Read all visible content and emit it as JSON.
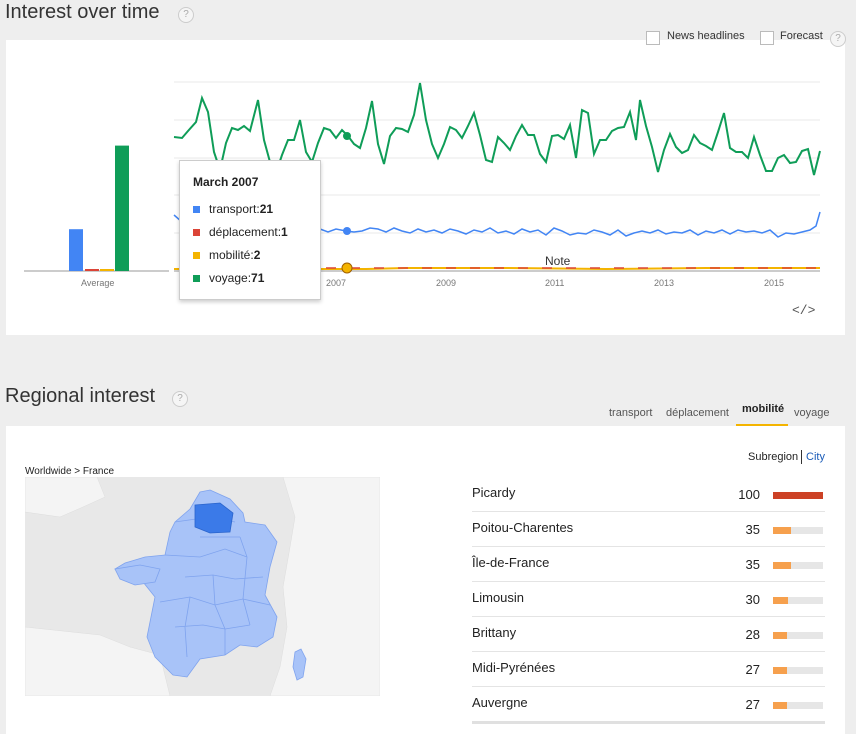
{
  "interest": {
    "title": "Interest over time",
    "help": "?",
    "news_label": "News headlines",
    "forecast_label": "Forecast",
    "average_label": "Average",
    "note_label": "Note",
    "embed_label": "</>",
    "years": [
      "2007",
      "2009",
      "2011",
      "2013",
      "2015"
    ],
    "averages": [
      {
        "name": "transport",
        "value": 22,
        "color": "#4285f4"
      },
      {
        "name": "déplacement",
        "value": 1,
        "color": "#db4437"
      },
      {
        "name": "mobilité",
        "value": 1,
        "color": "#f4b400"
      },
      {
        "name": "voyage",
        "value": 66,
        "color": "#0f9d58"
      }
    ],
    "tooltip": {
      "date": "March 2007",
      "rows": [
        {
          "label": "transport: ",
          "value": "21",
          "color": "#4285f4"
        },
        {
          "label": "déplacement: ",
          "value": "1",
          "color": "#db4437"
        },
        {
          "label": "mobilité: ",
          "value": "2",
          "color": "#f4b400"
        },
        {
          "label": "voyage: ",
          "value": "71",
          "color": "#0f9d58"
        }
      ]
    }
  },
  "regional": {
    "title": "Regional interest",
    "help": "?",
    "tabs": [
      "transport",
      "déplacement",
      "mobilité",
      "voyage"
    ],
    "active_tab": "mobilité",
    "subregion_label": "Subregion",
    "city_label": "City",
    "breadcrumb": "Worldwide > France",
    "rows": [
      {
        "name": "Picardy",
        "value": 100,
        "color": "#cc4125"
      },
      {
        "name": "Poitou-Charentes",
        "value": 35,
        "color": "#f6a04d"
      },
      {
        "name": "Île-de-France",
        "value": 35,
        "color": "#f6a04d"
      },
      {
        "name": "Limousin",
        "value": 30,
        "color": "#f6a04d"
      },
      {
        "name": "Brittany",
        "value": 28,
        "color": "#f6a04d"
      },
      {
        "name": "Midi-Pyrénées",
        "value": 27,
        "color": "#f6a04d"
      },
      {
        "name": "Auvergne",
        "value": 27,
        "color": "#f6a04d"
      }
    ]
  },
  "chart_data": {
    "type": "line",
    "series": [
      {
        "name": "transport",
        "color": "#4285f4"
      },
      {
        "name": "déplacement",
        "color": "#db4437"
      },
      {
        "name": "mobilité",
        "color": "#f4b400"
      },
      {
        "name": "voyage",
        "color": "#0f9d58"
      }
    ],
    "x_ticks": [
      "2007",
      "2009",
      "2011",
      "2013",
      "2015"
    ],
    "ylim": [
      0,
      100
    ],
    "grid": true,
    "highlight": {
      "date": "March 2007",
      "transport": 21,
      "déplacement": 1,
      "mobilité": 2,
      "voyage": 71
    }
  }
}
